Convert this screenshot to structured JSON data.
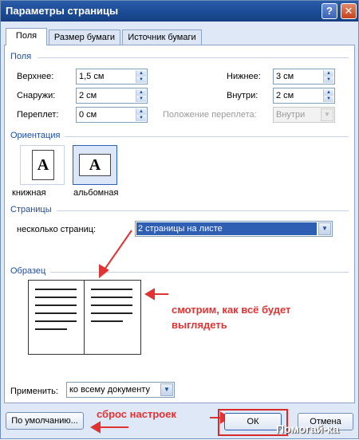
{
  "window": {
    "title": "Параметры страницы",
    "help_glyph": "?",
    "close_glyph": "✕"
  },
  "tabs": [
    {
      "label": "Поля",
      "active": true
    },
    {
      "label": "Размер бумаги",
      "active": false
    },
    {
      "label": "Источник бумаги",
      "active": false
    }
  ],
  "margins": {
    "group_label": "Поля",
    "top": {
      "label": "Верхнее:",
      "value": "1,5 см"
    },
    "left": {
      "label": "Снаружи:",
      "value": "2 см"
    },
    "gutter": {
      "label": "Переплет:",
      "value": "0 см"
    },
    "bottom": {
      "label": "Нижнее:",
      "value": "3 см"
    },
    "right": {
      "label": "Внутри:",
      "value": "2 см"
    },
    "gutter_position": {
      "label": "Положение переплета:",
      "value": "Внутри"
    }
  },
  "orientation": {
    "group_label": "Ориентация",
    "portrait": {
      "label": "книжная",
      "glyph": "A"
    },
    "landscape": {
      "label": "альбомная",
      "glyph": "A"
    }
  },
  "pages": {
    "group_label": "Страницы",
    "multiple": {
      "label": "несколько страниц:",
      "value": "2 страницы на листе"
    }
  },
  "preview": {
    "group_label": "Образец",
    "annotation": "смотрим, как всё будет\nвыглядеть"
  },
  "apply": {
    "label": "Применить:",
    "value": "ко всему документу"
  },
  "buttons": {
    "default_label": "По умолчанию...",
    "reset_annotation": "сброс настроек",
    "ok_label": "ОК",
    "cancel_label": "Отмена"
  },
  "watermark": "Помогай-ка",
  "colors": {
    "annotation": "#e03434",
    "title_bar": "#1b4a94",
    "group_label": "#1f4e99"
  }
}
